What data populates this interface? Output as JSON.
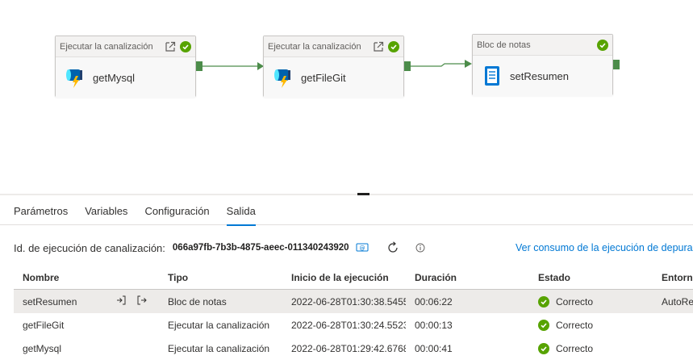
{
  "pipeline": {
    "nodes": [
      {
        "header": "Ejecutar la canalización",
        "name": "getMysql"
      },
      {
        "header": "Ejecutar la canalización",
        "name": "getFileGit"
      },
      {
        "header": "Bloc de notas",
        "name": "setResumen"
      }
    ]
  },
  "tabs": [
    "Parámetros",
    "Variables",
    "Configuración",
    "Salida"
  ],
  "active_tab": "Salida",
  "run": {
    "label": "Id. de ejecución de canalización:",
    "id": "066a97fb-7b3b-4875-aeec-011340243920",
    "consumption_link": "Ver consumo de la ejecución de depuración"
  },
  "table": {
    "headers": [
      "Nombre",
      "Tipo",
      "Inicio de la ejecución",
      "Duración",
      "Estado",
      "Entorno"
    ],
    "rows": [
      {
        "name": "setResumen",
        "type": "Bloc de notas",
        "start": "2022-06-28T01:30:38.5455",
        "duration": "00:06:22",
        "status": "Correcto",
        "env": "AutoRes"
      },
      {
        "name": "getFileGit",
        "type": "Ejecutar la canalización",
        "start": "2022-06-28T01:30:24.5523",
        "duration": "00:00:13",
        "status": "Correcto",
        "env": ""
      },
      {
        "name": "getMysql",
        "type": "Ejecutar la canalización",
        "start": "2022-06-28T01:29:42.6768",
        "duration": "00:00:41",
        "status": "Correcto",
        "env": ""
      }
    ]
  },
  "colors": {
    "accent": "#0078d4",
    "success": "#57a300",
    "connector": "#4c8c4a"
  }
}
